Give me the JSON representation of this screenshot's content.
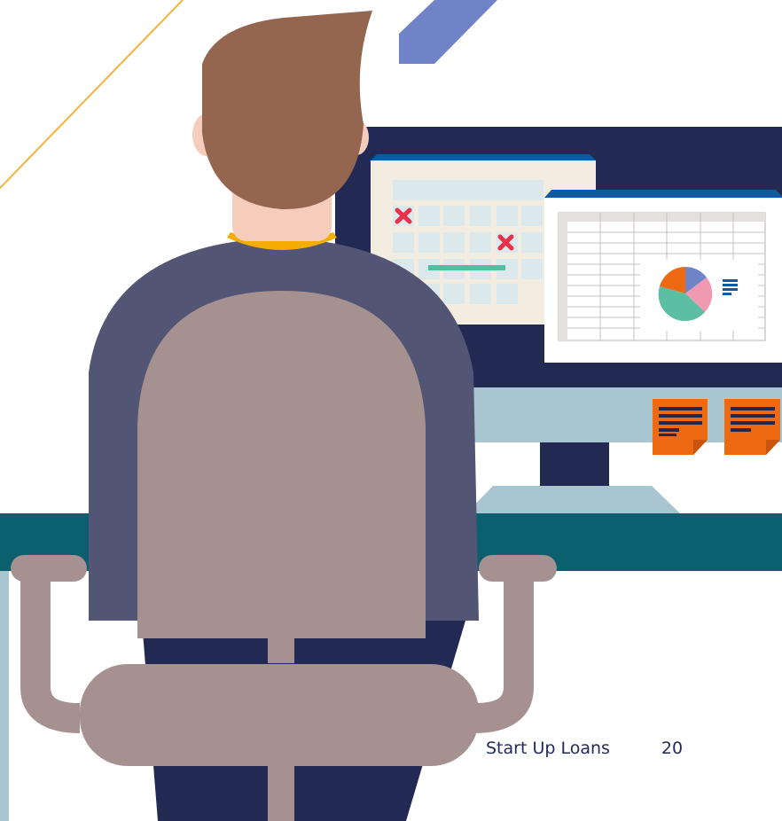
{
  "footer": {
    "brand": "Start Up Loans",
    "page_number": "20"
  },
  "colors": {
    "navy": "#1f2a55",
    "monitor_frame": "#222a54",
    "monitor_base": "#a9c6d0",
    "desk": "#0b5f6e",
    "chair": "#a69191",
    "sweater": "#525573",
    "hair": "#94654f",
    "skin": "#f6cdbd",
    "collar": "#f2ad00",
    "sticky_note": "#ee6a12",
    "window_titlebar": "#0f5aa4",
    "calendar_cell": "#dce9ec",
    "mark_red": "#e8324a",
    "bar_green": "#52bfa0",
    "accent_blue": "#7183c7",
    "accent_yellow": "#f2b33d"
  },
  "icons": [
    "close-mark-icon",
    "legend-lines-icon",
    "note-lines-icon"
  ]
}
